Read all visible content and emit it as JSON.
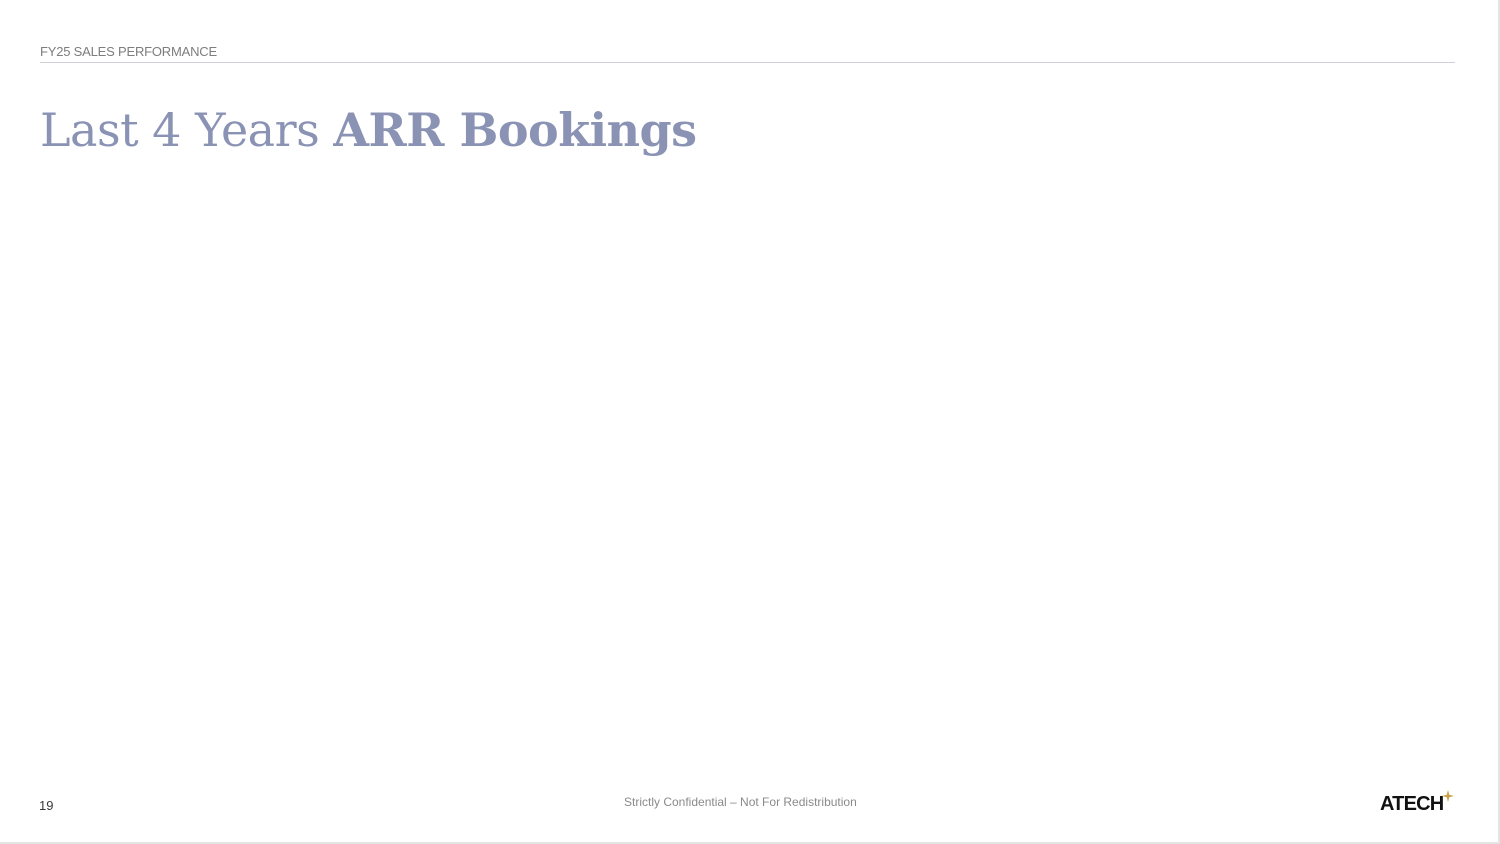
{
  "header": {
    "section_label": "FY25 SALES PERFORMANCE",
    "title_light": "Last 4 Years ",
    "title_bold": "ARR Bookings"
  },
  "footer": {
    "page_number": "19",
    "confidential_text": "Strictly Confidential – Not For Redistribution",
    "logo_text": "ATECH"
  },
  "colors": {
    "title": "#8b93b5",
    "logo_accent": "#c8a34a",
    "logo_text": "#111111"
  },
  "icons": {
    "logo_mark": "four-point-star-icon"
  }
}
